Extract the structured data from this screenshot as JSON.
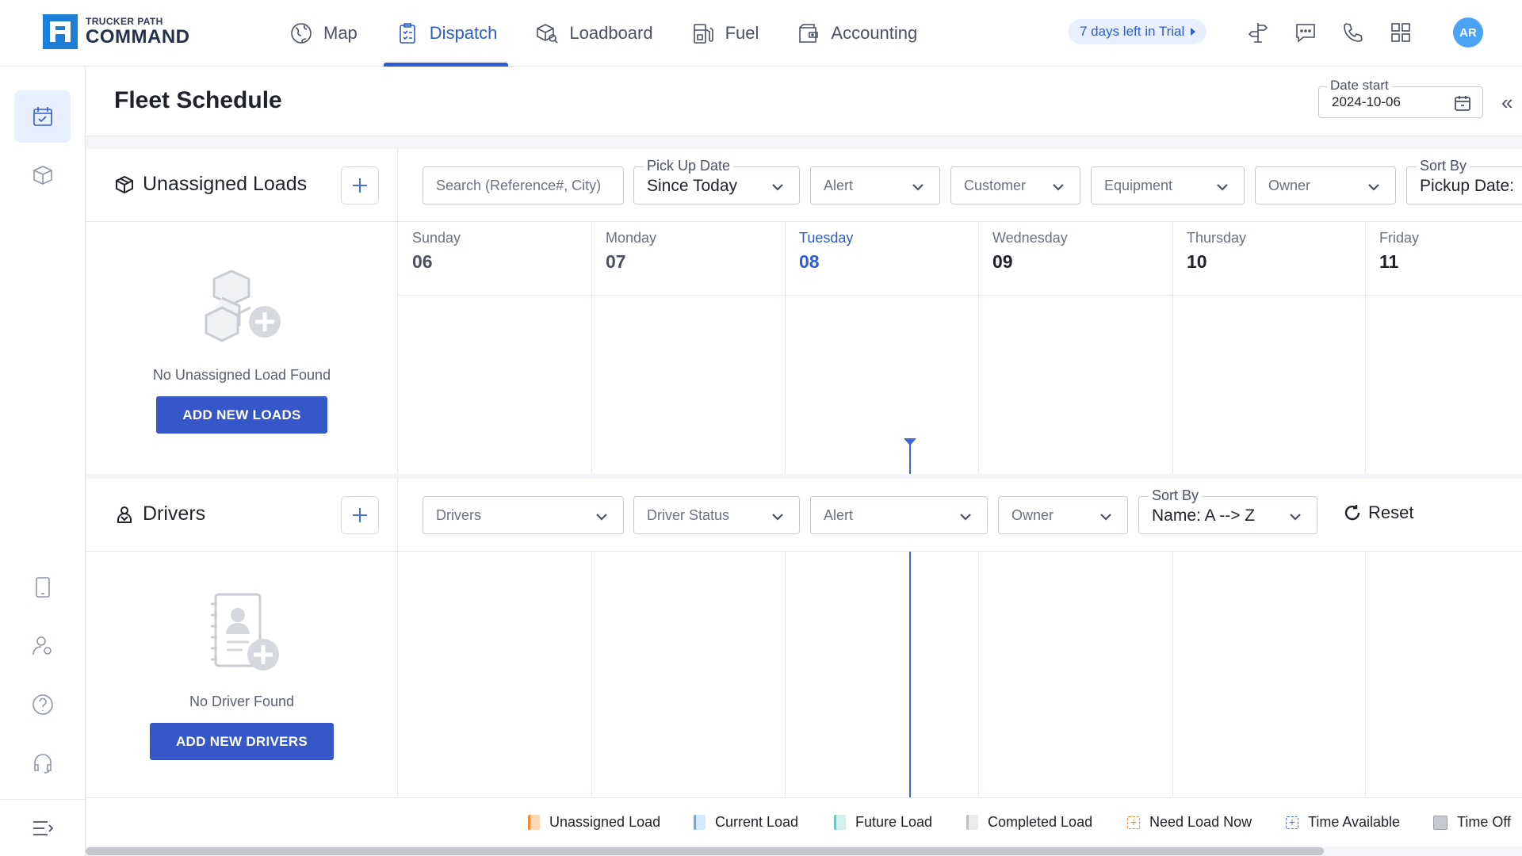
{
  "brand": {
    "top": "TRUCKER PATH",
    "bottom": "COMMAND"
  },
  "nav": [
    {
      "label": "Map",
      "icon": "map-icon",
      "active": false
    },
    {
      "label": "Dispatch",
      "icon": "dispatch-icon",
      "active": true
    },
    {
      "label": "Loadboard",
      "icon": "loadboard-icon",
      "active": false
    },
    {
      "label": "Fuel",
      "icon": "fuel-icon",
      "active": false
    },
    {
      "label": "Accounting",
      "icon": "accounting-icon",
      "active": false
    }
  ],
  "trial": {
    "label": "7 days left in Trial"
  },
  "user": {
    "initials": "AR"
  },
  "page": {
    "title": "Fleet Schedule",
    "date_start_label": "Date start",
    "date_start_value": "2024-10-06"
  },
  "loads": {
    "title": "Unassigned Loads",
    "search_placeholder": "Search (Reference#, City)",
    "pickup_label": "Pick Up Date",
    "pickup_value": "Since Today",
    "alert_placeholder": "Alert",
    "customer_placeholder": "Customer",
    "equipment_placeholder": "Equipment",
    "owner_placeholder": "Owner",
    "sort_label": "Sort By",
    "sort_value": "Pickup Date:",
    "empty_message": "No Unassigned Load Found",
    "add_button": "ADD NEW LOADS"
  },
  "days": [
    {
      "name": "Sunday",
      "date": "06"
    },
    {
      "name": "Monday",
      "date": "07"
    },
    {
      "name": "Tuesday",
      "date": "08"
    },
    {
      "name": "Wednesday",
      "date": "09"
    },
    {
      "name": "Thursday",
      "date": "10"
    },
    {
      "name": "Friday",
      "date": "11"
    }
  ],
  "drivers": {
    "title": "Drivers",
    "drivers_placeholder": "Drivers",
    "status_placeholder": "Driver Status",
    "alert_placeholder": "Alert",
    "owner_placeholder": "Owner",
    "sort_label": "Sort By",
    "sort_value": "Name: A --> Z",
    "reset_label": "Reset",
    "empty_message": "No Driver Found",
    "add_button": "ADD NEW DRIVERS"
  },
  "legend": [
    {
      "label": "Unassigned Load",
      "color": "#f7a35c"
    },
    {
      "label": "Current Load",
      "color": "#a9cdf2"
    },
    {
      "label": "Future Load",
      "color": "#a7dcd6"
    },
    {
      "label": "Completed Load",
      "color": "#d9d9d9"
    },
    {
      "label": "Need Load Now",
      "color": "#f7a35c"
    },
    {
      "label": "Time Available",
      "color": "#4c6fdc"
    },
    {
      "label": "Time Off",
      "color": "#b8bec7"
    }
  ],
  "colors": {
    "accent": "#2f5bd3",
    "button": "#3557c7",
    "brand": "#1c7ed6"
  }
}
